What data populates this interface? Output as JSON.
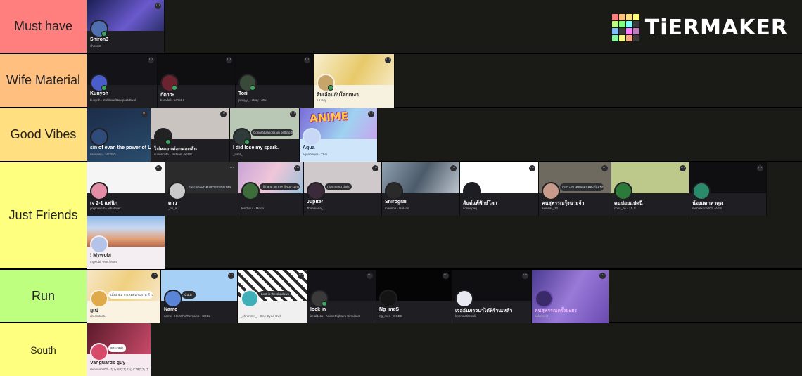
{
  "brand": {
    "logo_text": "TiERMAKER",
    "logo_colors": [
      "#ff7f7f",
      "#ffbf7f",
      "#ffdf7f",
      "#ffff7f",
      "#bfff7f",
      "#7fff7f",
      "#7fffff",
      "#7fbfff",
      "#7f7fff",
      "#ff7fff",
      "#bf7fbf",
      "#3b3b3b",
      "#85f7a3",
      "#f7f785",
      "#f7a885",
      "#85c1f7"
    ]
  },
  "tiers": [
    {
      "label": "Must have",
      "color": "#ff7f7f",
      "items": [
        {
          "name": "Shiron3",
          "handle": "shiron3",
          "banner": "#2b2f6b",
          "avatar": "#4f6fb0"
        }
      ]
    },
    {
      "label": "Wife Material",
      "color": "#ffbf7f",
      "items": [
        {
          "name": "Kunyoh",
          "handle": "kunyoh · Yoh/Hee/Hewpost/Pixel",
          "banner": "#141418",
          "avatar": "#4a5ec9"
        },
        {
          "name": "กัดาวะ",
          "handle": "kamdeli · HOMU",
          "banner": "#0f0f12",
          "avatar": "#6b2330"
        },
        {
          "name": "Tori",
          "handle": "pinyyy_ · Pray · 0IN",
          "banner": "#0f0f12",
          "avatar": "#3a4a3a"
        },
        {
          "name": "ลืมเลือนกับโลกเหงา",
          "handle": "fur.vwy",
          "banner": "#f1e5b5",
          "avatar": "#c7a56a",
          "light": true
        }
      ]
    },
    {
      "label": "Good Vibes",
      "color": "#ffdf7f",
      "items": [
        {
          "name": "sin of evan the power of Lucis",
          "handle": "itsevaisu · HEIS/G",
          "banner": "#1c2c48",
          "avatar": "#2e4b7a"
        },
        {
          "name": "ไม่หลอนต่อกต่อกลั่น",
          "handle": "sunnnnyfe · fashion · KING",
          "banner": "#c9c4c0",
          "avatar": "#222222"
        },
        {
          "name": "I did lose my spark.",
          "handle": "_nara_",
          "banner": "#b9c8b4",
          "avatar": "#2f3b38",
          "status": "Congratulations on getting through it, I'm the only one..."
        },
        {
          "name": "Aqua",
          "handle": "aquaplayer · Thai",
          "banner": "#9fd2f0",
          "avatar": "#c7d7f5",
          "anime": "ANIME"
        }
      ]
    },
    {
      "label": "Just Friends",
      "color": "#ffff7f",
      "items": [
        {
          "name": "เจ 2-1 แฟนิก",
          "handle": "jingmaiitub · whatever",
          "banner": "#f5f5f5",
          "avatar": "#e38ea6"
        },
        {
          "name": "ดาว",
          "handle": "_rvi_ai",
          "banner": "#2b2b2b",
          "avatar": "#c9c9c9",
          "status": "Fascinated: ดีเตยายามยัง เหมือนไม่ขยายตรอกยาก"
        },
        {
          "name": "",
          "handle": "tendyvui · Moon",
          "banner": "#d9a9c4",
          "avatar": "#3d6d3a",
          "status": "I'll hang on me! if you can't save me tight here"
        },
        {
          "name": "Jupiter",
          "handle": "Jhaaaiana_",
          "banner": "#cfc9cb",
          "avatar": "#3a2a3a",
          "status": "I luv mang chris"
        },
        {
          "name": "Shirograi",
          "handle": "marinoa · HaHas",
          "banner": "#4c5b6a",
          "avatar": "#2a2a2a"
        },
        {
          "name": "สันต์แพ้พักษ์โลก",
          "handle": "sonnapaq",
          "banner": "#ffffff",
          "avatar": "#1d1d24"
        },
        {
          "name": "คนสุพรรณรุ้งนายจ้า",
          "handle": "aiensas_12",
          "banner": "#6e6a60",
          "avatar": "#c79a8a",
          "status": "เพราะไม่ได้ตลอดแค่จะเป็นเรื่อยๆ"
        },
        {
          "name": "คนปอยแปดนี",
          "handle": "chris_ze · JJLS",
          "banner": "#bcc98a",
          "avatar": "#2c7a3a"
        },
        {
          "name": "น้องแตกหาคุด",
          "handle": "mahalxoca001 · AES",
          "banner": "#0f0f12",
          "avatar": "#2a8a6a"
        },
        {
          "name": "! Mywobi",
          "handle": "mywobi · Me / Mam",
          "banner": "#e1a078",
          "avatar": "#b3c4e8",
          "light": true
        }
      ]
    },
    {
      "label": "Run",
      "color": "#bfff7f",
      "items": [
        {
          "name": "ยุเน่",
          "handle": "dreamtoatu",
          "banner": "#f6e6c6",
          "avatar": "#e0a94a",
          "light": true,
          "status": "เบี้ยง่ายมากแหลดนกแหวน ตำบลอุพา"
        },
        {
          "name": "Namc",
          "handle": "namc · He/Who/Remains · SDEL",
          "banner": "#a7d0f7",
          "avatar": "#5a84d6",
          "status": "ฉันเทา"
        },
        {
          "name": "",
          "handle": "_chromOn_ · One-Eyed Owl",
          "banner": "#d4d4d4",
          "avatar": "#3fb0b8",
          "status": "Lost in the shadows"
        },
        {
          "name": "lock in",
          "handle": "irHal1111 · AnimeFighters Simulator",
          "banner": "#141418",
          "avatar": "#3a3a3a"
        },
        {
          "name": "Ng_meS",
          "handle": "ng_mes · CGDB",
          "banner": "#050505",
          "avatar": "#141414"
        },
        {
          "name": "เจออันภาวนาได้ที่ร้านเหล้า",
          "handle": "konmnatitesuli",
          "banner": "#0f0f12",
          "avatar": "#e8e8f0"
        },
        {
          "name": "คนสุพรรณครั้งยะยร",
          "handle": "kakamei3",
          "banner": "#6a4ab0",
          "avatar": "#3a2a6a"
        }
      ]
    },
    {
      "label": "South",
      "color": "#7fff7f",
      "items": [
        {
          "name": "Vanguards guy",
          "handle": "raiheuan000 · ならあなたの心に輝ただけ",
          "banner": "#7a2a3a",
          "avatar": "#d84a6a",
          "light": true,
          "status": "ตอนเหล่า"
        }
      ]
    }
  ]
}
